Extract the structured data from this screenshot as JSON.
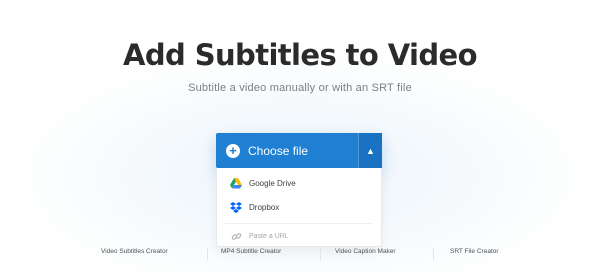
{
  "header": {
    "title": "Add Subtitles to Video",
    "subtitle": "Subtitle a video manually or with an SRT file"
  },
  "upload": {
    "choose_label": "Choose file",
    "dropdown": [
      {
        "label": "Google Drive",
        "icon": "google-drive-icon"
      },
      {
        "label": "Dropbox",
        "icon": "dropbox-icon"
      }
    ],
    "url_placeholder": "Paste a URL"
  },
  "footer": {
    "links": [
      "Video Subtitles Creator",
      "MP4 Subtitle Creator",
      "Video Caption Maker",
      "SRT File Creator"
    ]
  },
  "colors": {
    "accent": "#1f7fd3",
    "title": "#2b2b2b"
  }
}
